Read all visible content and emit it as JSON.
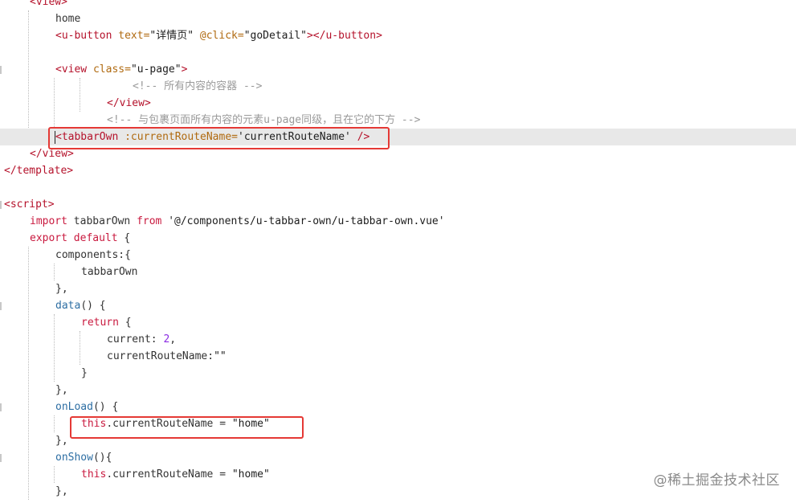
{
  "editor": {
    "lines": [
      {
        "tokens": [
          [
            "tag",
            "<view>"
          ]
        ]
      },
      {
        "tokens": [
          [
            "plain",
            "home"
          ]
        ]
      },
      {
        "tokens": [
          [
            "tag",
            "<u-button"
          ],
          [
            "plain",
            " "
          ],
          [
            "attr",
            "text="
          ],
          [
            "str",
            "\"详情页\""
          ],
          [
            "plain",
            " "
          ],
          [
            "attr",
            "@click="
          ],
          [
            "str",
            "\"goDetail\""
          ],
          [
            "tag",
            "></u-button>"
          ]
        ]
      },
      {
        "tokens": []
      },
      {
        "tokens": [
          [
            "tag",
            "<view"
          ],
          [
            "plain",
            " "
          ],
          [
            "attr",
            "class="
          ],
          [
            "str",
            "\"u-page\""
          ],
          [
            "tag",
            ">"
          ]
        ]
      },
      {
        "tokens": [
          [
            "com",
            "<!-- 所有内容的容器 -->"
          ]
        ]
      },
      {
        "tokens": [
          [
            "tag",
            "</view>"
          ]
        ]
      },
      {
        "tokens": [
          [
            "com",
            "<!-- 与包裹页面所有内容的元素u-page同级，且在它的下方 -->"
          ]
        ]
      },
      {
        "tokens": [
          [
            "tag",
            "<tabbarOwn"
          ],
          [
            "plain",
            " "
          ],
          [
            "attr",
            ":currentRouteName="
          ],
          [
            "str",
            "'currentRouteName'"
          ],
          [
            "plain",
            " "
          ],
          [
            "tag",
            "/>"
          ]
        ]
      },
      {
        "tokens": [
          [
            "tag",
            "</view>"
          ]
        ]
      },
      {
        "tokens": [
          [
            "tag",
            "</template>"
          ]
        ]
      },
      {
        "tokens": []
      },
      {
        "tokens": [
          [
            "tag",
            "<script>"
          ]
        ]
      },
      {
        "tokens": [
          [
            "kw",
            "import"
          ],
          [
            "plain",
            " tabbarOwn "
          ],
          [
            "kw",
            "from"
          ],
          [
            "plain",
            " "
          ],
          [
            "str",
            "'@/components/u-tabbar-own/u-tabbar-own.vue'"
          ]
        ]
      },
      {
        "tokens": [
          [
            "kw",
            "export"
          ],
          [
            "plain",
            " "
          ],
          [
            "kw",
            "default"
          ],
          [
            "plain",
            " {"
          ]
        ]
      },
      {
        "tokens": [
          [
            "plain",
            "components:{"
          ]
        ]
      },
      {
        "tokens": [
          [
            "plain",
            "tabbarOwn"
          ]
        ]
      },
      {
        "tokens": [
          [
            "plain",
            "},"
          ]
        ]
      },
      {
        "tokens": [
          [
            "fn",
            "data"
          ],
          [
            "plain",
            "() {"
          ]
        ]
      },
      {
        "tokens": [
          [
            "kw",
            "return"
          ],
          [
            "plain",
            " {"
          ]
        ]
      },
      {
        "tokens": [
          [
            "plain",
            "current: "
          ],
          [
            "num",
            "2"
          ],
          [
            "plain",
            ","
          ]
        ]
      },
      {
        "tokens": [
          [
            "plain",
            "currentRouteName:"
          ],
          [
            "str",
            "\"\""
          ]
        ]
      },
      {
        "tokens": [
          [
            "plain",
            "}"
          ]
        ]
      },
      {
        "tokens": [
          [
            "plain",
            "},"
          ]
        ]
      },
      {
        "tokens": [
          [
            "fn",
            "onLoad"
          ],
          [
            "plain",
            "() {"
          ]
        ]
      },
      {
        "tokens": [
          [
            "kw",
            "this"
          ],
          [
            "plain",
            ".currentRouteName = "
          ],
          [
            "str",
            "\"home\""
          ]
        ]
      },
      {
        "tokens": [
          [
            "plain",
            "},"
          ]
        ]
      },
      {
        "tokens": [
          [
            "fn",
            "onShow"
          ],
          [
            "plain",
            "(){"
          ]
        ]
      },
      {
        "tokens": [
          [
            "kw",
            "this"
          ],
          [
            "plain",
            ".currentRouteName = "
          ],
          [
            "str",
            "\"home\""
          ]
        ]
      },
      {
        "tokens": [
          [
            "plain",
            "},"
          ]
        ]
      }
    ]
  },
  "watermark": {
    "text": "@稀土掘金技术社区"
  },
  "colors": {
    "highlight_border": "#e53935",
    "current_line": "#e8e8e8"
  }
}
